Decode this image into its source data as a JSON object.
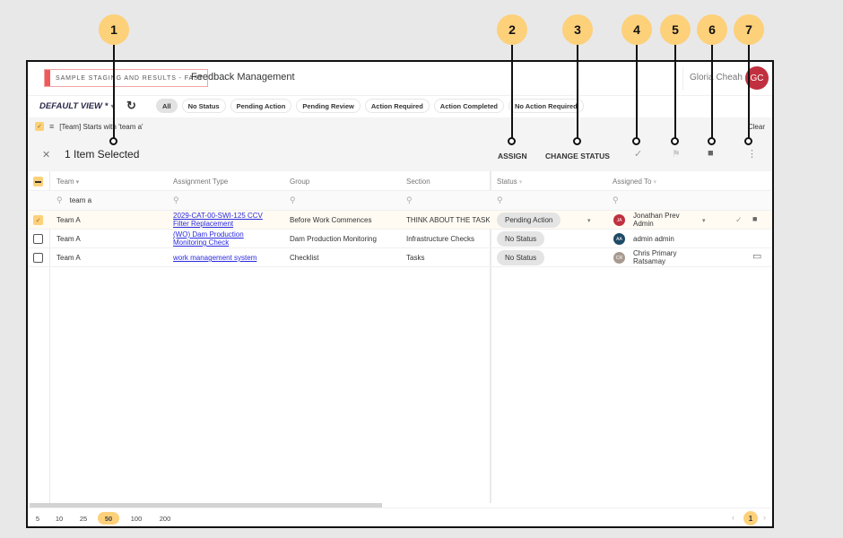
{
  "callouts": [
    "1",
    "2",
    "3",
    "4",
    "5",
    "6",
    "7"
  ],
  "header": {
    "env_badge": "SAMPLE STAGING AND RESULTS - FAST",
    "app_title": "Feedback Management",
    "user_name": "Gloria Cheah",
    "user_initials": "GC"
  },
  "viewbar": {
    "view_label": "DEFAULT VIEW *",
    "caret": "▾",
    "refresh_icon": "↻",
    "chips": [
      "All",
      "No Status",
      "Pending Action",
      "Pending Review",
      "Action Required",
      "Action Completed",
      "No Action Required"
    ],
    "active_chip": "All"
  },
  "filter": {
    "check": "✓",
    "icon": "≡",
    "text": "[Team] Starts with 'team a'",
    "clear_label": "Clear"
  },
  "selection": {
    "close_icon": "✕",
    "title": "1 Item Selected",
    "assign_label": "ASSIGN",
    "change_status_label": "CHANGE STATUS",
    "check_icon": "✓",
    "flag_icon": "⚑",
    "comment_icon": "■",
    "more_icon": "⋮"
  },
  "table": {
    "columns": [
      "Team",
      "Assignment Type",
      "Group",
      "Section",
      "Status",
      "Assigned To"
    ],
    "filter_glyph": "▾",
    "search_icon": "⚲",
    "team_search_value": "team a",
    "rows": [
      {
        "selected": true,
        "team": "Team A",
        "assignment_type_line1": "2029-CAT-00-SWI-125 CCV",
        "assignment_type_line2": "Filter Replacement",
        "group": "Before Work Commences",
        "section": "THINK ABOUT THE TASK",
        "status": "Pending Action",
        "assignee_initials": "JA",
        "assignee_line1": "Jonathan Prev",
        "assignee_line2": "Admin",
        "assignee_color": "#c0303e"
      },
      {
        "selected": false,
        "team": "Team A",
        "assignment_type_line1": "(WO) Dam Production",
        "assignment_type_line2": "Monitoring Check",
        "group": "Dam Production Monitoring",
        "section": "Infrastructure Checks",
        "status": "No Status",
        "assignee_initials": "AA",
        "assignee_line1": "admin admin",
        "assignee_line2": "",
        "assignee_color": "#1f4a66"
      },
      {
        "selected": false,
        "team": "Team A",
        "assignment_type_line1": "work management system",
        "assignment_type_line2": "",
        "group": "Checklist",
        "section": "Tasks",
        "status": "No Status",
        "assignee_initials": "CR",
        "assignee_line1": "Chris Primary",
        "assignee_line2": "Ratsamay",
        "assignee_color": "#a89a90"
      }
    ],
    "row_check_icon": "✓",
    "row_comment_icon": "■",
    "row_comment_outline_icon": "▭"
  },
  "footer": {
    "page_sizes": [
      "5",
      "10",
      "25",
      "50",
      "100",
      "200"
    ],
    "active_page_size": "50",
    "prev_icon": "‹",
    "next_icon": "›",
    "current_page": "1"
  },
  "colors": {
    "accent": "#fdd07a",
    "env_red": "#ee5a5a",
    "avatar_red": "#c0303e",
    "link": "#2a2ae0"
  }
}
